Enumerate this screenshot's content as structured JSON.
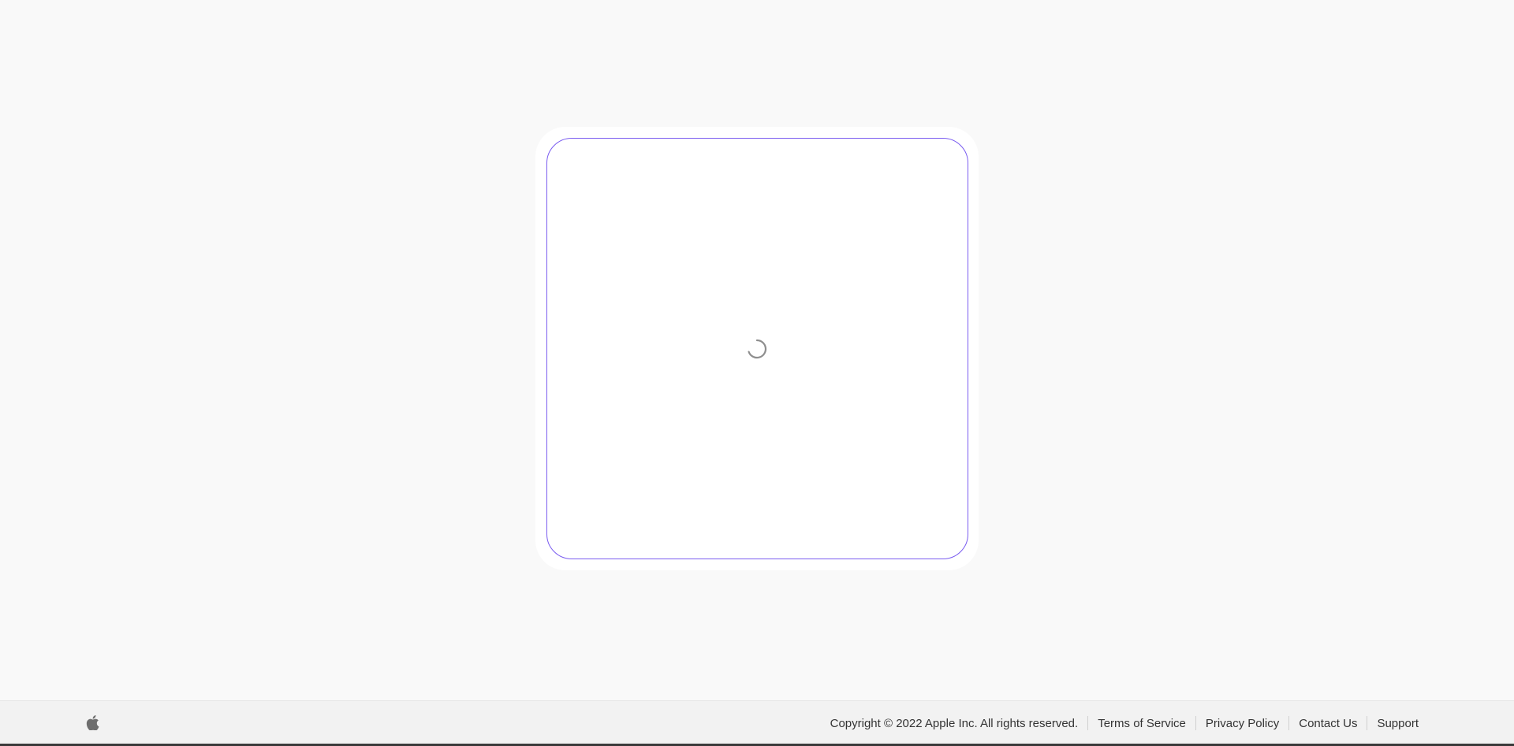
{
  "main": {
    "loading_indicator": "spinner-icon"
  },
  "footer": {
    "logo_icon": "apple-logo-icon",
    "copyright": "Copyright © 2022 Apple Inc. All rights reserved.",
    "links": [
      "Terms of Service",
      "Privacy Policy",
      "Contact Us",
      "Support"
    ]
  },
  "colors": {
    "page_background": "#f9f9f9",
    "card_border": "#7a5cf0",
    "footer_background": "#f2f2f2",
    "footer_text": "#333333"
  }
}
